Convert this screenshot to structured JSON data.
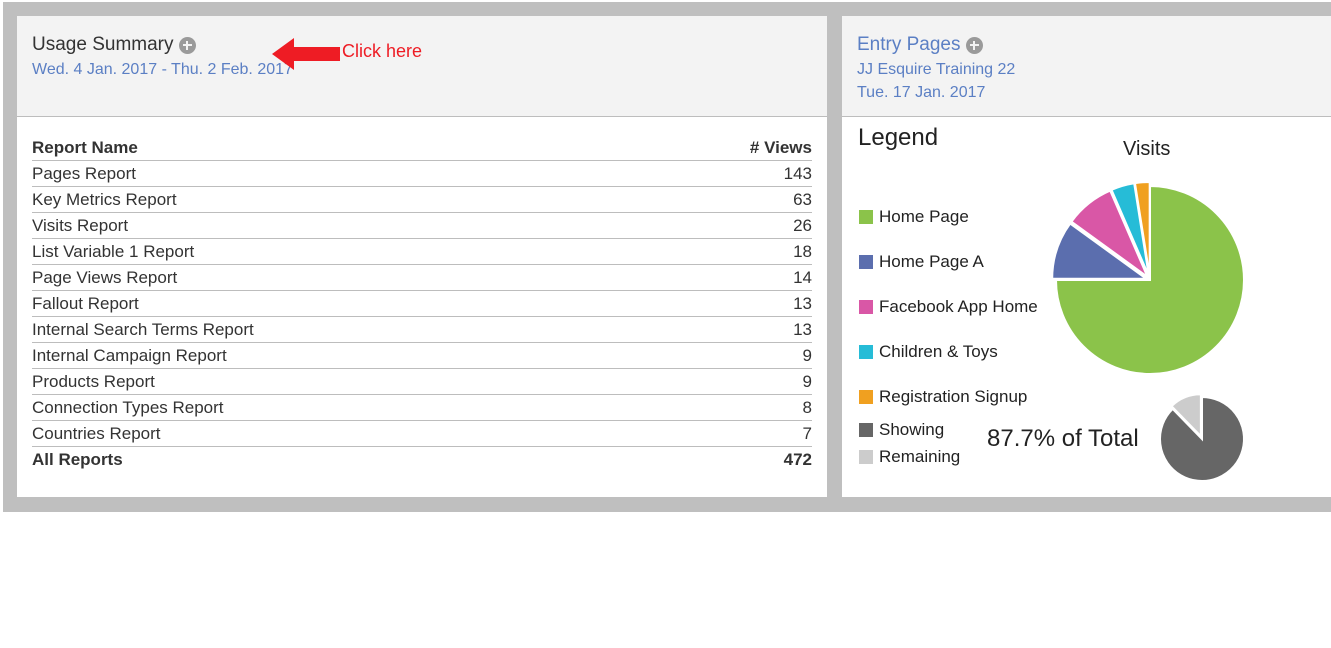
{
  "usage_summary": {
    "title": "Usage Summary",
    "date_range": "Wed. 4 Jan. 2017 - Thu. 2 Feb. 2017",
    "annotation": "Click here",
    "columns": [
      "Report Name",
      "# Views"
    ],
    "rows": [
      {
        "name": "Pages Report",
        "views": "143"
      },
      {
        "name": "Key Metrics Report",
        "views": "63"
      },
      {
        "name": "Visits Report",
        "views": "26"
      },
      {
        "name": "List Variable 1 Report",
        "views": "18"
      },
      {
        "name": "Page Views Report",
        "views": "14"
      },
      {
        "name": "Fallout Report",
        "views": "13"
      },
      {
        "name": "Internal Search Terms Report",
        "views": "13"
      },
      {
        "name": "Internal Campaign Report",
        "views": "9"
      },
      {
        "name": "Products Report",
        "views": "9"
      },
      {
        "name": "Connection Types Report",
        "views": "8"
      },
      {
        "name": "Countries Report",
        "views": "7"
      }
    ],
    "total": {
      "name": "All Reports",
      "views": "472"
    }
  },
  "entry_pages": {
    "title": "Entry Pages",
    "report_suite": "JJ Esquire Training 22",
    "date": "Tue. 17 Jan. 2017",
    "legend_title": "Legend",
    "percent_of_total": "87.7% of Total"
  },
  "colors": {
    "accent_blue": "#5b7fc4",
    "annotation_red": "#ee1c24"
  },
  "chart_data": [
    {
      "type": "pie",
      "title": "Visits",
      "legend_position": "left",
      "slices": [
        {
          "label": "Home Page",
          "value": 75.0,
          "color": "#8bc34a"
        },
        {
          "label": "Home Page A",
          "value": 10.0,
          "color": "#5b6eae"
        },
        {
          "label": "Facebook App Home",
          "value": 8.5,
          "color": "#d957a6"
        },
        {
          "label": "Children & Toys",
          "value": 4.0,
          "color": "#26bcd7"
        },
        {
          "label": "Registration Signup",
          "value": 2.5,
          "color": "#f0a020"
        }
      ]
    },
    {
      "type": "pie",
      "title": "87.7% of Total",
      "slices": [
        {
          "label": "Showing",
          "value": 87.7,
          "color": "#666666"
        },
        {
          "label": "Remaining",
          "value": 12.3,
          "color": "#cccccc"
        }
      ]
    }
  ]
}
